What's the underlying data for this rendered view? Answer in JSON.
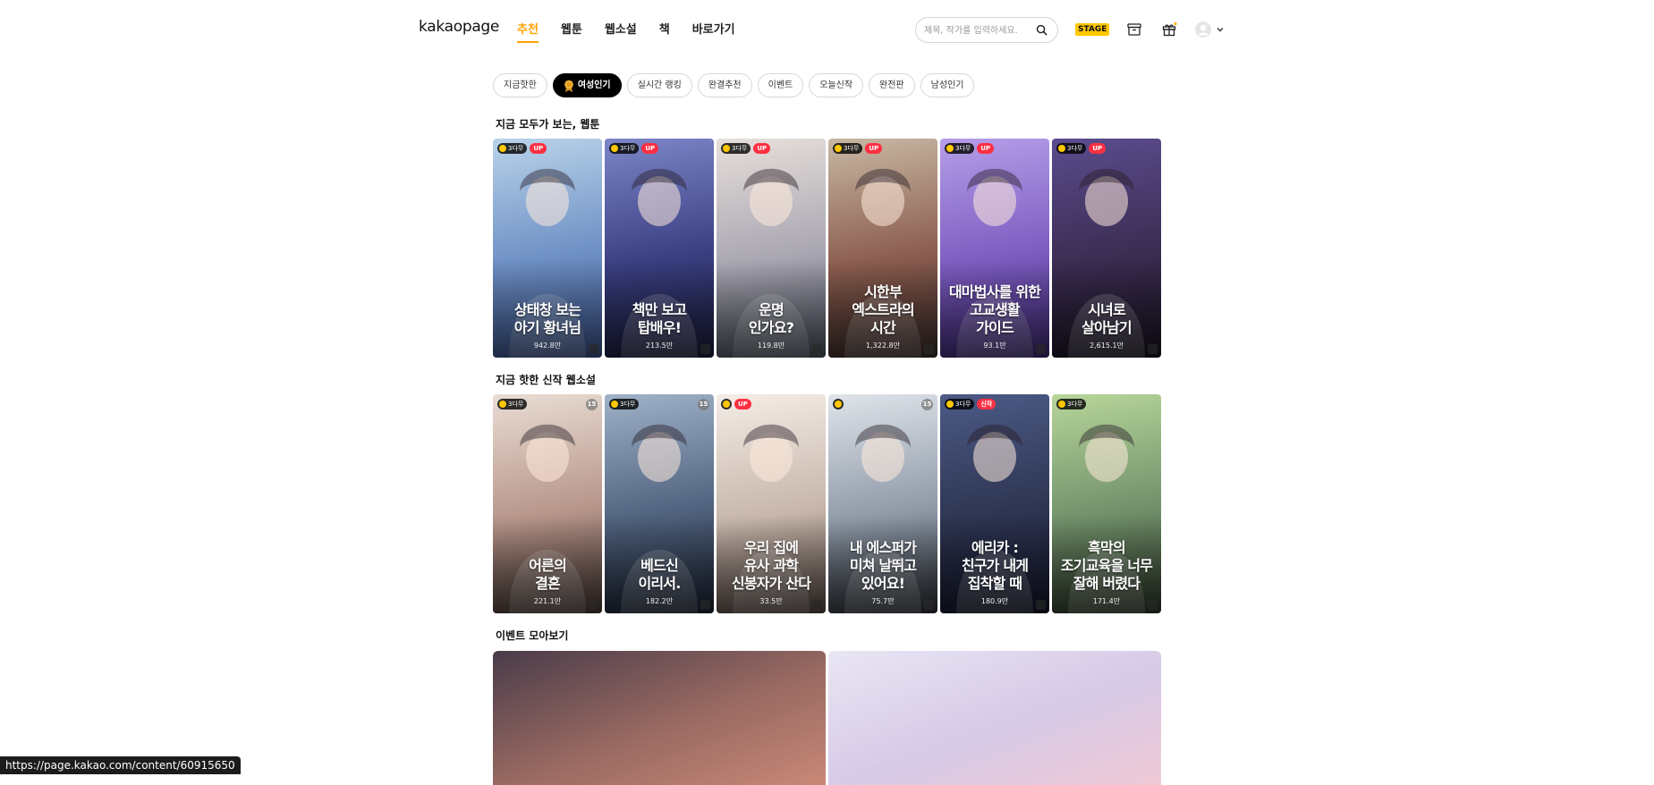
{
  "header": {
    "logo": "kakaopage",
    "nav": [
      {
        "label": "추천",
        "active": true
      },
      {
        "label": "웹툰",
        "active": false
      },
      {
        "label": "웹소설",
        "active": false
      },
      {
        "label": "책",
        "active": false
      },
      {
        "label": "바로가기",
        "active": false
      }
    ],
    "search_placeholder": "제목, 작가를 입력하세요.",
    "stage_label": "STAGE"
  },
  "chips": [
    {
      "label": "지금핫한",
      "active": false
    },
    {
      "label": "여성인기",
      "active": true
    },
    {
      "label": "실시간 랭킹",
      "active": false
    },
    {
      "label": "완결추천",
      "active": false
    },
    {
      "label": "이벤트",
      "active": false
    },
    {
      "label": "오늘신작",
      "active": false
    },
    {
      "label": "완전판",
      "active": false
    },
    {
      "label": "남성인기",
      "active": false
    }
  ],
  "sections": {
    "webtoon_title": "지금 모두가 보는, 웹툰",
    "novel_title": "지금 핫한 신작 웹소설",
    "event_title": "이벤트 모아보기"
  },
  "webtoons": [
    {
      "title": "상태창 보는\n아기 황녀님",
      "views": "942.8만",
      "wait": "3다무",
      "badge": "UP",
      "bg": [
        "#b9d3ea",
        "#6d8fc4",
        "#3c5590"
      ]
    },
    {
      "title": "책만 보고\n탑배우!",
      "views": "213.5만",
      "wait": "3다무",
      "badge": "UP",
      "bg": [
        "#7c86c8",
        "#3a3f82",
        "#1b1d3d"
      ]
    },
    {
      "title": "운명\n인가요?",
      "views": "119.8만",
      "wait": "3다무",
      "badge": "UP",
      "bg": [
        "#e7dfda",
        "#a9a6b2",
        "#4c5562"
      ]
    },
    {
      "title": "시한부\n엑스트라의\n시간",
      "views": "1,322.8만",
      "wait": "3다무",
      "badge": "UP",
      "bg": [
        "#c8b8a4",
        "#8c5d4f",
        "#3c2d2a"
      ]
    },
    {
      "title": "대마법사를 위한\n고교생활\n가이드",
      "views": "93.1만",
      "wait": "3다무",
      "badge": "UP",
      "bg": [
        "#b59ee8",
        "#7d5cc1",
        "#3f2a78"
      ]
    },
    {
      "title": "시녀로\n살아남기",
      "views": "2,615.1만",
      "wait": "3다무",
      "badge": "UP",
      "bg": [
        "#5b4c8e",
        "#3b2c52",
        "#1a1422"
      ]
    }
  ],
  "novels": [
    {
      "title": "어른의\n결혼",
      "views": "221.1만",
      "wait": "3다무",
      "badge": "",
      "age": "15",
      "bg": [
        "#e9ddd4",
        "#b7958a",
        "#4a3b36"
      ]
    },
    {
      "title": "베드신\n이리서.",
      "views": "182.2만",
      "wait": "3다무",
      "badge": "",
      "age": "15",
      "bg": [
        "#9fb2c9",
        "#50627e",
        "#1c2435"
      ]
    },
    {
      "title": "우리 집에\n유사 과학\n신봉자가 산다",
      "views": "33.5만",
      "wait": "",
      "badge": "UP",
      "age": "",
      "bg": [
        "#f4ede6",
        "#c7b6ab",
        "#5a4b45"
      ]
    },
    {
      "title": "내 에스퍼가\n미쳐 날뛰고\n있어요!",
      "views": "75.7만",
      "wait": "",
      "badge": "",
      "age": "15",
      "bg": [
        "#dfe4ea",
        "#8f9aa8",
        "#2d3138"
      ]
    },
    {
      "title": "에리카 :\n친구가 내게\n집착할 때",
      "views": "180.9만",
      "wait": "3다무",
      "badge": "신작",
      "age": "",
      "bg": [
        "#4c5a86",
        "#2e3552",
        "#13172a"
      ]
    },
    {
      "title": "흑막의\n조기교육을 너무\n잘해 버렸다",
      "views": "171.4만",
      "wait": "3다무",
      "badge": "",
      "age": "",
      "bg": [
        "#b7d69a",
        "#71906a",
        "#2e3a2a"
      ]
    }
  ],
  "events": [
    {
      "bg": [
        "#4a3c4a",
        "#9a6a62",
        "#c98877"
      ]
    },
    {
      "bg": [
        "#e9e6f4",
        "#d6c9e6",
        "#f0c9d6"
      ]
    }
  ],
  "status_url": "https://page.kakao.com/content/60915650"
}
